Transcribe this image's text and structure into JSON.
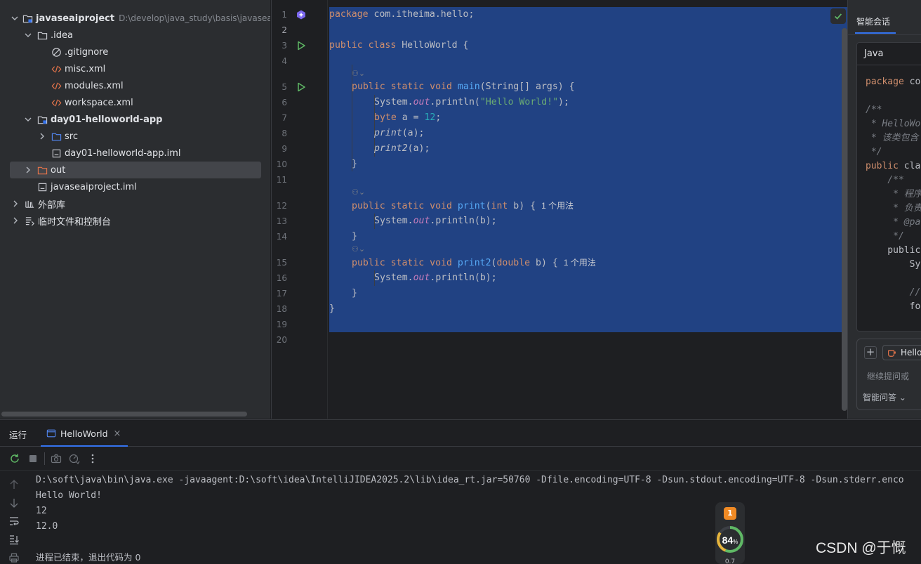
{
  "project": {
    "root_name": "javaseaiproject",
    "root_path": "D:\\develop\\java_study\\basis\\javaseaipro",
    "items": [
      {
        "label": ".idea"
      },
      {
        "label": ".gitignore"
      },
      {
        "label": "misc.xml"
      },
      {
        "label": "modules.xml"
      },
      {
        "label": "workspace.xml"
      },
      {
        "label": "day01-helloworld-app"
      },
      {
        "label": "src"
      },
      {
        "label": "day01-helloworld-app.iml"
      },
      {
        "label": "out"
      },
      {
        "label": "javaseaiproject.iml"
      },
      {
        "label": "外部库"
      },
      {
        "label": "临时文件和控制台"
      }
    ]
  },
  "editor": {
    "line_numbers": [
      "1",
      "2",
      "3",
      "4",
      "5",
      "6",
      "7",
      "8",
      "9",
      "10",
      "11",
      "12",
      "13",
      "14",
      "15",
      "16",
      "17",
      "18",
      "19",
      "20"
    ],
    "code": {
      "l1_kw": "package",
      "l1_rest": " com.itheima.hello;",
      "l3_kw": "public class",
      "l3_rest": " HelloWorld {",
      "l5_kw": "public static void",
      "l5_fn": "main",
      "l5_rest": "(String[] args) {",
      "l6_a": "System.",
      "l6_field": "out",
      "l6_b": ".println(",
      "l6_str": "\"Hello World!\"",
      "l6_c": ");",
      "l7_kw": "byte",
      "l7_a": " a = ",
      "l7_num": "12",
      "l7_b": ";",
      "l8_fn": "print",
      "l8_rest": "(a);",
      "l9_fn": "print2",
      "l9_rest": "(a);",
      "brace_close": "}",
      "l12_kw": "public static void",
      "l12_fn": "print",
      "l12_a": "(",
      "l12_kw2": "int",
      "l12_b": " b) {",
      "l13_a": "System.",
      "l13_field": "out",
      "l13_b": ".println(b);",
      "l15_kw": "public static void",
      "l15_fn": "print2",
      "l15_a": "(",
      "l15_kw2": "double",
      "l15_b": " b) {",
      "l16_a": "System.",
      "l16_field": "out",
      "l16_b": ".println(b);"
    },
    "usage_hint": "1 个用法"
  },
  "ai_panel": {
    "tab_label": "智能会话",
    "code_language": "Java",
    "code_lines": [
      {
        "kind": "kw",
        "text": "package",
        "rest": " co"
      },
      {
        "kind": "cm",
        "text": "/**"
      },
      {
        "kind": "cm",
        "text": " * HelloWo"
      },
      {
        "kind": "cm",
        "text": " * 该类包含"
      },
      {
        "kind": "cm",
        "text": " */"
      },
      {
        "kind": "kw",
        "text": "public",
        "rest": " cla"
      },
      {
        "kind": "cm",
        "text": "    /**"
      },
      {
        "kind": "cm",
        "text": "     * 程序"
      },
      {
        "kind": "cm",
        "text": "     * 负责"
      },
      {
        "kind": "cm",
        "text": "     * @pa"
      },
      {
        "kind": "cm",
        "text": "     */"
      },
      {
        "kind": "kw",
        "text": "    public"
      },
      {
        "kind": "plain",
        "text": "        Sy"
      },
      {
        "kind": "cm",
        "text": "        //"
      },
      {
        "kind": "kw",
        "text": "        fo"
      }
    ],
    "chip_label": "Hello",
    "input_placeholder": "继续提问或",
    "mode_label": "智能问答"
  },
  "run_panel": {
    "title": "运行",
    "tab_label": "HelloWorld",
    "output_lines": [
      "D:\\soft\\java\\bin\\java.exe -javaagent:D:\\soft\\idea\\IntelliJIDEA2025.2\\lib\\idea_rt.jar=50760 -Dfile.encoding=UTF-8 -Dsun.stdout.encoding=UTF-8 -Dsun.stderr.enco",
      "Hello World!",
      "12",
      "12.0",
      "",
      "进程已结束，退出代码为 0"
    ]
  },
  "badge": {
    "top_number": "1",
    "score": "84",
    "score_unit": "%",
    "bottom_text": "0.7"
  },
  "watermark": "CSDN @于慨",
  "colors": {
    "selection": "#214283",
    "keyword": "#cf8e6d",
    "function": "#56a8f5",
    "string": "#6aab73",
    "number": "#2aacb8",
    "accent": "#3574f0"
  }
}
